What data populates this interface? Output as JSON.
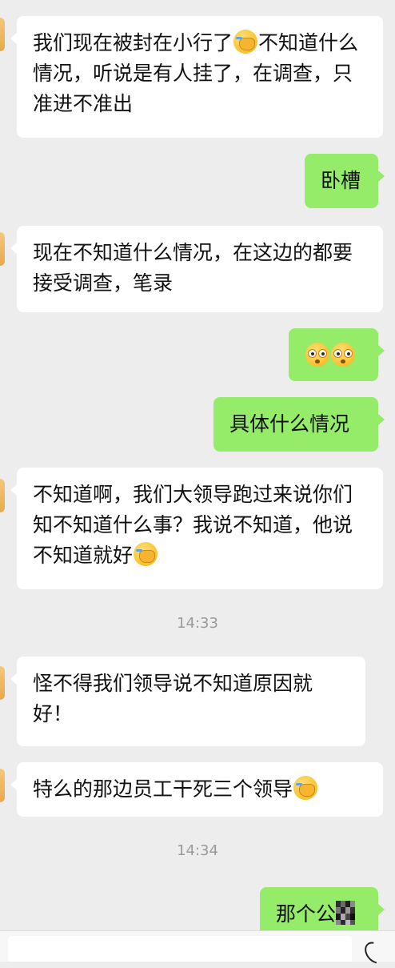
{
  "messages": [
    {
      "side": "left",
      "text_a": "我们现在被封在小行了",
      "text_b": "不知道什么情况，听说是有人挂了，在调查，只准进不准出"
    },
    {
      "side": "right",
      "text": "卧槽"
    },
    {
      "side": "left",
      "text": "现在不知道什么情况，在这边的都要接受调查，笔录"
    },
    {
      "side": "right",
      "emoji": "flushed-face-icon x2"
    },
    {
      "side": "right",
      "text": "具体什么情况"
    },
    {
      "side": "left",
      "text": "不知道啊，我们大领导跑过来说你们知不知道什么事？我说不知道，他说不知道就好"
    },
    {
      "side": "left",
      "text": "怪不得我们领导说不知道原因就好！"
    },
    {
      "side": "left",
      "text": "特么的那边员工干死三个领导"
    },
    {
      "side": "right",
      "text": "那个公"
    }
  ],
  "timestamps": {
    "t1": "14:33",
    "t2": "14:34"
  },
  "colors": {
    "background": "#ededed",
    "incoming_bubble": "#ffffff",
    "outgoing_bubble": "#95ec69",
    "timestamp_text": "#9a9a9a"
  },
  "icons": {
    "facepalm": "facepalm-emoji-icon",
    "flushed": "flushed-face-emoji-icon",
    "censor": "pixelated-censor-icon",
    "input": "voice-input-icon"
  }
}
